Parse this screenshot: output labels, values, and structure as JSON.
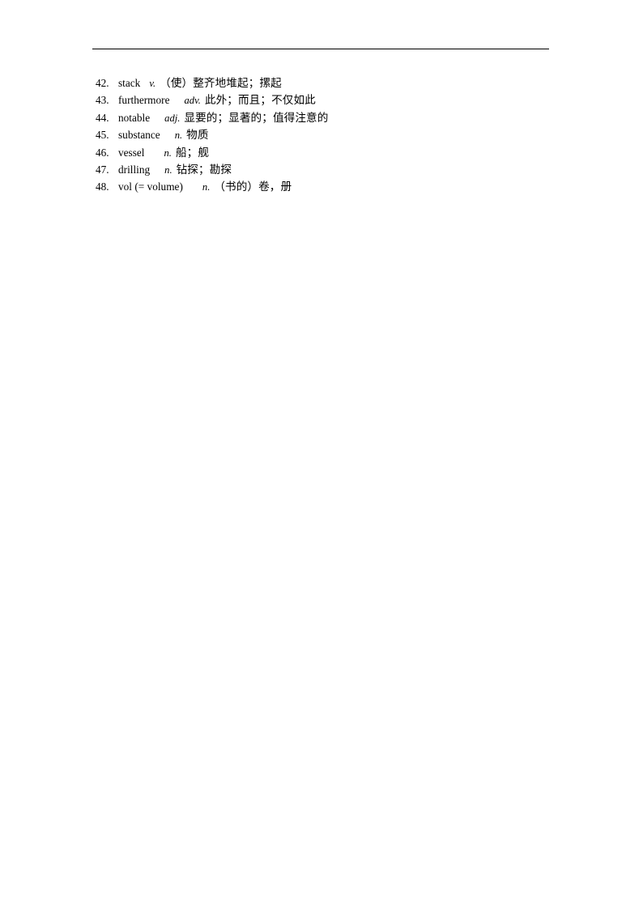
{
  "document": {
    "type": "vocabulary-list-page",
    "header_rule_visible": true,
    "text_color": "#000000",
    "background_color": "#ffffff"
  },
  "vocabulary": {
    "entries": [
      {
        "number": "42.",
        "word": "stack",
        "pos": "v.",
        "definition": "（使）整齐地堆起；摞起"
      },
      {
        "number": "43.",
        "word": "furthermore",
        "pos": "adv.",
        "definition": "此外；而且；不仅如此"
      },
      {
        "number": "44.",
        "word": "notable",
        "pos": "adj.",
        "definition": "显要的；显著的；值得注意的"
      },
      {
        "number": "45.",
        "word": "substance",
        "pos": "n.",
        "definition": "物质"
      },
      {
        "number": "46.",
        "word": "vessel",
        "pos": "n.",
        "definition": "船；舰"
      },
      {
        "number": "47.",
        "word": "drilling",
        "pos": "n.",
        "definition": "钻探；勘探"
      },
      {
        "number": "48.",
        "word": "vol (= volume)",
        "pos": "n.",
        "definition": "（书的）卷，册"
      }
    ]
  }
}
